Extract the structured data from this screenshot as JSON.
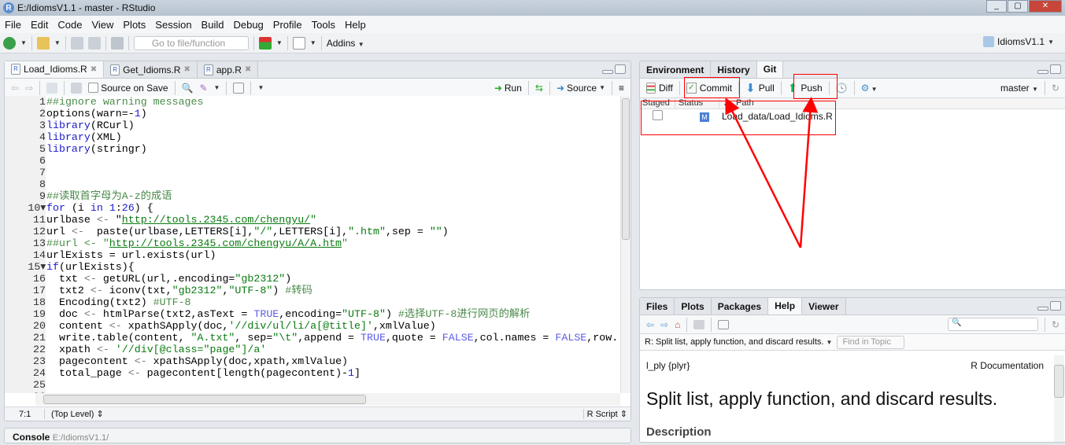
{
  "window": {
    "title": "E:/IdiomsV1.1 - master - RStudio"
  },
  "menu": [
    "File",
    "Edit",
    "Code",
    "View",
    "Plots",
    "Session",
    "Build",
    "Debug",
    "Profile",
    "Tools",
    "Help"
  ],
  "toolbar": {
    "goto_placeholder": "Go to file/function",
    "addins": "Addins",
    "project": "IdiomsV1.1"
  },
  "editor": {
    "tabs": [
      "Load_Idioms.R",
      "Get_Idioms.R",
      "app.R"
    ],
    "source_on_save": "Source on Save",
    "run": "Run",
    "source": "Source",
    "status": {
      "position": "7:1",
      "scope": "(Top Level)",
      "type": "R Script"
    },
    "lines": [
      [
        [
          "com",
          "##ignore warning messages"
        ]
      ],
      [
        [
          "",
          "options(warn=-"
        ],
        [
          "num",
          "1"
        ],
        [
          "",
          ")"
        ]
      ],
      [
        [
          "kw",
          "library"
        ],
        [
          "",
          "(RCurl)"
        ]
      ],
      [
        [
          "kw",
          "library"
        ],
        [
          "",
          "(XML)"
        ]
      ],
      [
        [
          "kw",
          "library"
        ],
        [
          "",
          "(stringr)"
        ]
      ],
      [],
      [],
      [],
      [
        [
          "com",
          "##读取首字母为A-z的成语"
        ]
      ],
      [
        [
          "kw",
          "for"
        ],
        [
          "",
          " (i "
        ],
        [
          "kw",
          "in"
        ],
        [
          "",
          " "
        ],
        [
          "num",
          "1"
        ],
        [
          "",
          ":"
        ],
        [
          "num",
          "26"
        ],
        [
          "",
          ") {"
        ]
      ],
      [
        [
          "",
          "urlbase "
        ],
        [
          "op",
          "<-"
        ],
        [
          "",
          " \""
        ],
        [
          "url",
          "http://tools.2345.com/chengyu/"
        ],
        [
          "str",
          "\""
        ]
      ],
      [
        [
          "",
          "url "
        ],
        [
          "op",
          "<-"
        ],
        [
          "",
          "  paste(urlbase,LETTERS[i],"
        ],
        [
          "str",
          "\"/\""
        ],
        [
          "",
          ",LETTERS[i],"
        ],
        [
          "str",
          "\".htm\""
        ],
        [
          "",
          ",sep = "
        ],
        [
          "str",
          "\"\""
        ],
        [
          "",
          ")"
        ]
      ],
      [
        [
          "com",
          "##url <- \""
        ],
        [
          "url",
          "http://tools.2345.com/chengyu/A/A.htm"
        ],
        [
          "com",
          "\""
        ]
      ],
      [
        [
          "",
          "urlExists = url.exists(url)"
        ]
      ],
      [
        [
          "kw",
          "if"
        ],
        [
          "",
          "(urlExists){"
        ]
      ],
      [
        [
          "",
          "  txt "
        ],
        [
          "op",
          "<-"
        ],
        [
          "",
          " getURL(url,.encoding="
        ],
        [
          "str",
          "\"gb2312\""
        ],
        [
          "",
          ")"
        ]
      ],
      [
        [
          "",
          "  txt2 "
        ],
        [
          "op",
          "<-"
        ],
        [
          "",
          " iconv(txt,"
        ],
        [
          "str",
          "\"gb2312\""
        ],
        [
          "",
          ","
        ],
        [
          "str",
          "\"UTF-8\""
        ],
        [
          "",
          ") "
        ],
        [
          "com",
          "#转码"
        ]
      ],
      [
        [
          "",
          "  Encoding(txt2) "
        ],
        [
          "com",
          "#UTF-8"
        ]
      ],
      [
        [
          "",
          "  doc "
        ],
        [
          "op",
          "<-"
        ],
        [
          "",
          " htmlParse(txt2,asText = "
        ],
        [
          "bool",
          "TRUE"
        ],
        [
          "",
          ",encoding="
        ],
        [
          "str",
          "\"UTF-8\""
        ],
        [
          "",
          ") "
        ],
        [
          "com",
          "#选择UTF-8进行网页的解析"
        ]
      ],
      [
        [
          "",
          "  content "
        ],
        [
          "op",
          "<-"
        ],
        [
          "",
          " xpathSApply(doc,"
        ],
        [
          "str",
          "'//div/ul/li/a[@title]'"
        ],
        [
          "",
          ",xmlValue)"
        ]
      ],
      [
        [
          "",
          "  write.table(content, "
        ],
        [
          "str",
          "\"A.txt\""
        ],
        [
          "",
          ", sep="
        ],
        [
          "str",
          "\"\\t\""
        ],
        [
          "",
          ",append = "
        ],
        [
          "bool",
          "TRUE"
        ],
        [
          "",
          ",quote = "
        ],
        [
          "bool",
          "FALSE"
        ],
        [
          "",
          ",col.names = "
        ],
        [
          "bool",
          "FALSE"
        ],
        [
          "",
          ",row."
        ]
      ],
      [
        [
          "",
          "  xpath "
        ],
        [
          "op",
          "<-"
        ],
        [
          "",
          " "
        ],
        [
          "str",
          "'//div[@class=\"page\"]/a'"
        ]
      ],
      [
        [
          "",
          "  pagecontent "
        ],
        [
          "op",
          "<-"
        ],
        [
          "",
          " xpathSApply(doc,xpath,xmlValue)"
        ]
      ],
      [
        [
          "",
          "  total_page "
        ],
        [
          "op",
          "<-"
        ],
        [
          "",
          " pagecontent[length(pagecontent)-"
        ],
        [
          "num",
          "1"
        ],
        [
          "",
          "]"
        ]
      ],
      [],
      []
    ]
  },
  "console": {
    "title": "Console",
    "path": "E:/IdiomsV1.1/"
  },
  "git_pane": {
    "tabs": [
      "Environment",
      "History",
      "Git"
    ],
    "buttons": {
      "diff": "Diff",
      "commit": "Commit",
      "pull": "Pull",
      "push": "Push"
    },
    "branch": "master",
    "columns": [
      "Staged",
      "Status",
      "Path"
    ],
    "files": [
      {
        "staged": false,
        "status": "M",
        "path": "Load_data/Load_Idioms.R"
      }
    ]
  },
  "help_pane": {
    "tabs": [
      "Files",
      "Plots",
      "Packages",
      "Help",
      "Viewer"
    ],
    "topic": "R: Split list, apply function, and discard results.",
    "find_placeholder": "Find in Topic",
    "pkg": "l_ply {plyr}",
    "rdoc": "R Documentation",
    "heading": "Split list, apply function, and discard results.",
    "section": "Description"
  },
  "colors": {
    "annotation": "#ff0000",
    "accent": "#3a6fc4"
  }
}
